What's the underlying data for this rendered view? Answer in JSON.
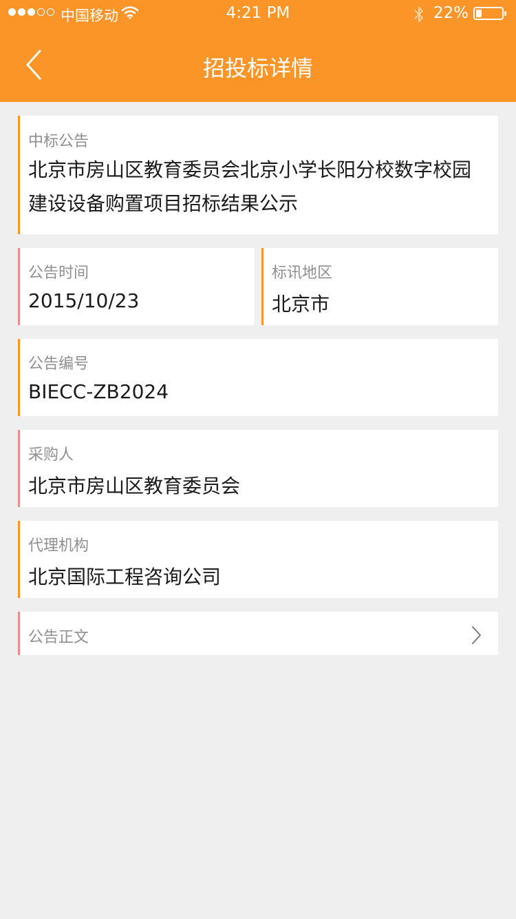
{
  "status_bar": {
    "carrier": "中国移动",
    "time": "4:21 PM",
    "battery_percent": "22%",
    "battery_level": 0.22,
    "signal_bars_filled": 3,
    "signal_bars_total": 5,
    "icons": [
      "wifi-icon",
      "bluetooth-icon",
      "battery-icon"
    ]
  },
  "nav": {
    "title": "招投标详情",
    "back_icon": "chevron-left-icon"
  },
  "details": {
    "award": {
      "label": "中标公告",
      "value": "北京市房山区教育委员会北京小学长阳分校数字校园建设设备购置项目招标结果公示"
    },
    "publish_time": {
      "label": "公告时间",
      "value": "2015/10/23"
    },
    "region": {
      "label": "标讯地区",
      "value": "北京市"
    },
    "notice_number": {
      "label": "公告编号",
      "value": "BIECC-ZB2024"
    },
    "purchaser": {
      "label": "采购人",
      "value": "北京市房山区教育委员会"
    },
    "agency": {
      "label": "代理机构",
      "value": "北京国际工程咨询公司"
    },
    "body_link": {
      "label": "公告正文",
      "icon": "chevron-right-icon"
    }
  },
  "colors": {
    "accent": "#fb9527",
    "accent_pink": "#f08a86",
    "background": "#efefef",
    "card": "#ffffff",
    "label_text": "#8f8f8f",
    "value_text": "#1a1a1a"
  }
}
